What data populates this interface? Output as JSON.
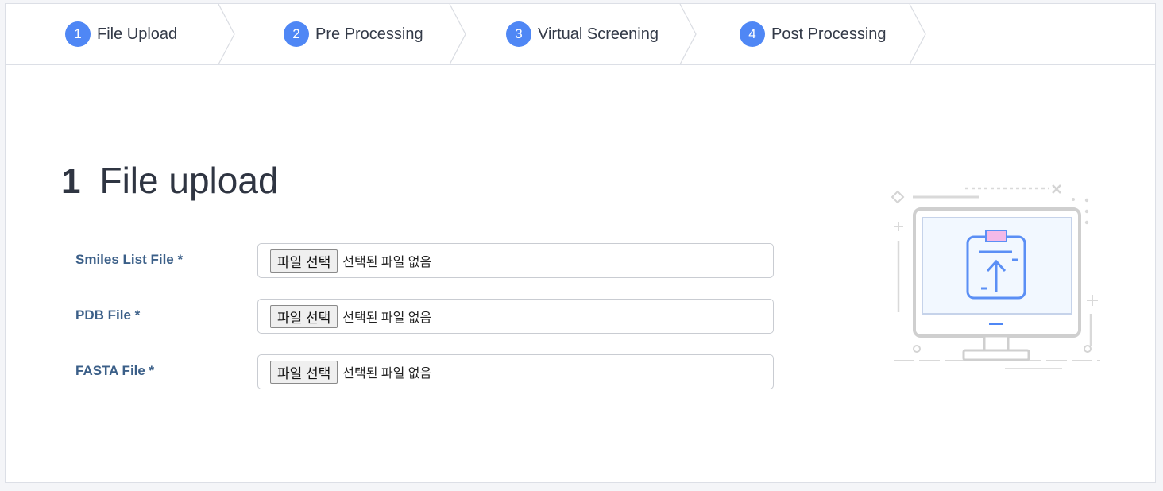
{
  "stepper": {
    "steps": [
      {
        "num": "1",
        "label": "File Upload"
      },
      {
        "num": "2",
        "label": "Pre Processing"
      },
      {
        "num": "3",
        "label": "Virtual Screening"
      },
      {
        "num": "4",
        "label": "Post Processing"
      }
    ]
  },
  "section": {
    "number": "1",
    "title": "File upload"
  },
  "fields": [
    {
      "label": "Smiles List File *",
      "button": "파일 선택",
      "status": "선택된 파일 없음"
    },
    {
      "label": "PDB File *",
      "button": "파일 선택",
      "status": "선택된 파일 없음"
    },
    {
      "label": "FASTA File *",
      "button": "파일 선택",
      "status": "선택된 파일 없음"
    }
  ],
  "colors": {
    "accent": "#4f87f5",
    "label": "#3b5f88",
    "illustration_pink": "#f3b9e8",
    "illustration_screen": "#f2f8ff"
  },
  "icons": {
    "illustration": "computer-upload-illustration"
  }
}
